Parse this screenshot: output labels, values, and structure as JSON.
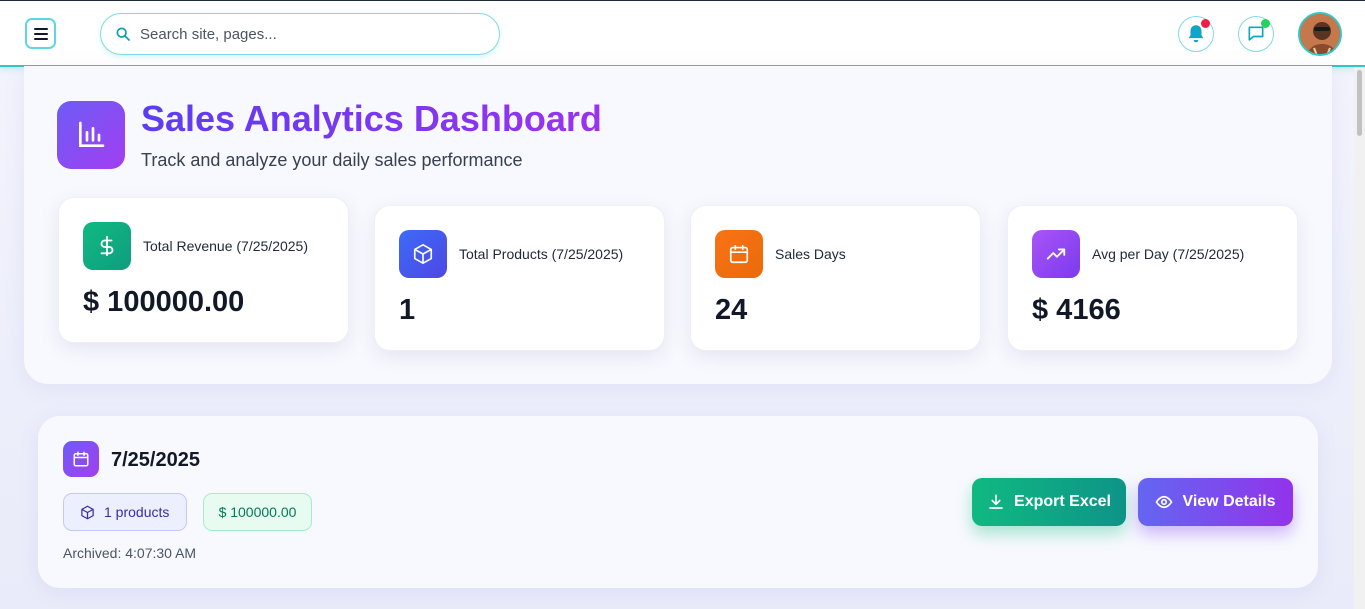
{
  "topbar": {
    "search_placeholder": "Search site, pages...",
    "notification_dot_color": "#ef1d4a",
    "message_dot_color": "#22d35e",
    "accent_color": "#2fc7c9"
  },
  "header": {
    "title": "Sales Analytics Dashboard",
    "subtitle": "Track and analyze your daily sales performance"
  },
  "stats": [
    {
      "icon": "dollar-icon",
      "label": "Total Revenue (7/25/2025)",
      "value": "$ 100000.00",
      "color": "#10b981"
    },
    {
      "icon": "box-icon",
      "label": "Total Products (7/25/2025)",
      "value": "1",
      "color": "#3b6cf6"
    },
    {
      "icon": "calendar-icon",
      "label": "Sales Days",
      "value": "24",
      "color": "#f97316"
    },
    {
      "icon": "trending-up-icon",
      "label": "Avg per Day (7/25/2025)",
      "value": "$ 4166",
      "color": "#9333ea"
    }
  ],
  "archive": {
    "date": "7/25/2025",
    "products_badge": "1 products",
    "amount_badge": "$ 100000.00",
    "archived_time": "Archived: 4:07:30 AM",
    "export_label": "Export Excel",
    "view_label": "View Details"
  }
}
